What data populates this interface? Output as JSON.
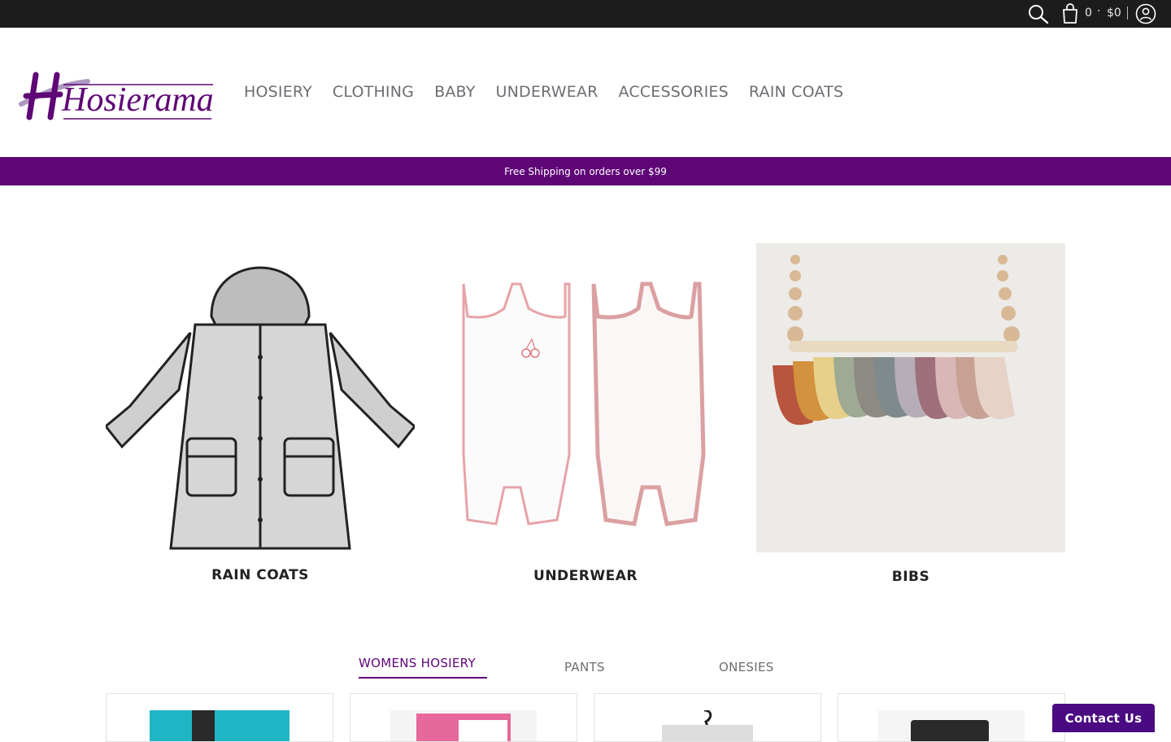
{
  "topbar": {
    "search_icon": "search-icon",
    "cart_icon": "cart-icon",
    "cart_count": "0",
    "cart_separator": "·",
    "cart_total": "$0",
    "account_icon": "account-icon"
  },
  "header": {
    "logo_text": "Hosierama",
    "nav": [
      {
        "label": "HOSIERY"
      },
      {
        "label": "CLOTHING"
      },
      {
        "label": "BABY"
      },
      {
        "label": "UNDERWEAR"
      },
      {
        "label": "ACCESSORIES"
      },
      {
        "label": "RAIN COATS"
      }
    ]
  },
  "promo": {
    "text": "Free Shipping on orders over $99"
  },
  "collections": [
    {
      "title": "RAIN COATS"
    },
    {
      "title": "UNDERWEAR"
    },
    {
      "title": "BIBS"
    }
  ],
  "tabs": [
    {
      "label": "WOMENS HOSIERY"
    },
    {
      "label": "PANTS"
    },
    {
      "label": "ONESIES"
    }
  ],
  "colors": {
    "brand_purple": "#5f0677",
    "topbar_bg": "#1c1c1c",
    "contact_bg": "#4b0a82"
  },
  "contact": {
    "label": "Contact Us"
  }
}
